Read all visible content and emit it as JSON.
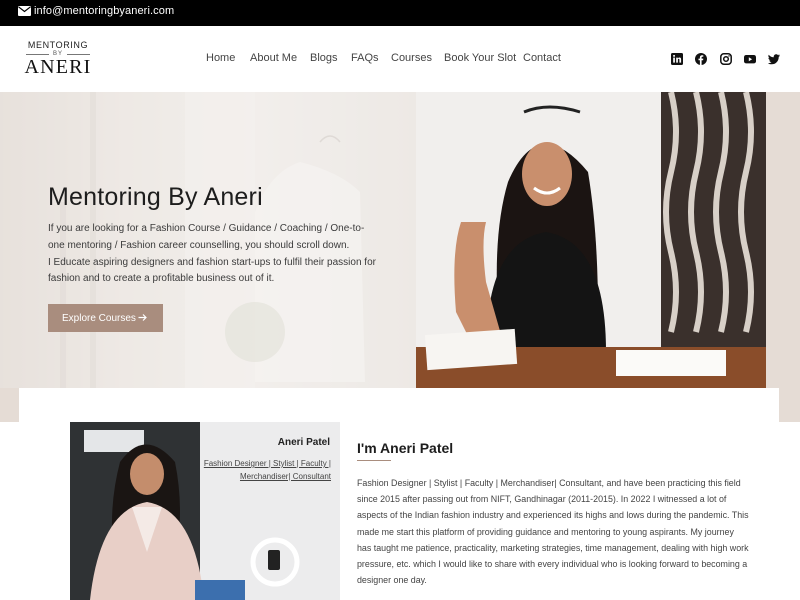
{
  "topbar": {
    "email": "info@mentoringbyaneri.com"
  },
  "logo": {
    "line1": "MENTORING",
    "line2": "BY",
    "line3": "ANERI"
  },
  "nav": [
    {
      "label": "Home"
    },
    {
      "label": "About Me"
    },
    {
      "label": "Blogs"
    },
    {
      "label": "FAQs"
    },
    {
      "label": "Courses"
    },
    {
      "label": "Book Your Slot"
    },
    {
      "label": "Contact"
    }
  ],
  "social": [
    "linkedin-icon",
    "facebook-icon",
    "instagram-icon",
    "youtube-icon",
    "twitter-icon"
  ],
  "hero": {
    "title": "Mentoring By Aneri",
    "paragraph1": "If you are looking for a Fashion Course / Guidance / Coaching / One-to-one mentoring / Fashion career counselling, you should scroll down.",
    "paragraph2": "I Educate aspiring designers and fashion start-ups to fulfil their passion for fashion and to create a profitable business out of it.",
    "button_label": "Explore Courses"
  },
  "about": {
    "photo_name": "Aneri Patel",
    "photo_subtitle": "Fashion Designer | Stylist | Faculty | Merchandiser| Consultant",
    "heading": "I'm Aneri Patel",
    "body": "Fashion Designer | Stylist | Faculty | Merchandiser| Consultant, and have been practicing this field since 2015 after passing out from NIFT, Gandhinagar (2011-2015). In 2022 I witnessed a lot of aspects of the Indian fashion industry and experienced its highs and lows during the pandemic. This made me start this platform of providing guidance and mentoring to young aspirants. My journey has taught me patience, practicality, marketing strategies, time management, dealing with high work pressure, etc. which I would like to share with every individual who is looking forward to becoming a designer one day."
  },
  "colors": {
    "accent": "#a98d7e",
    "topbar": "#000000",
    "hero_bg": "#e5dcd5"
  }
}
